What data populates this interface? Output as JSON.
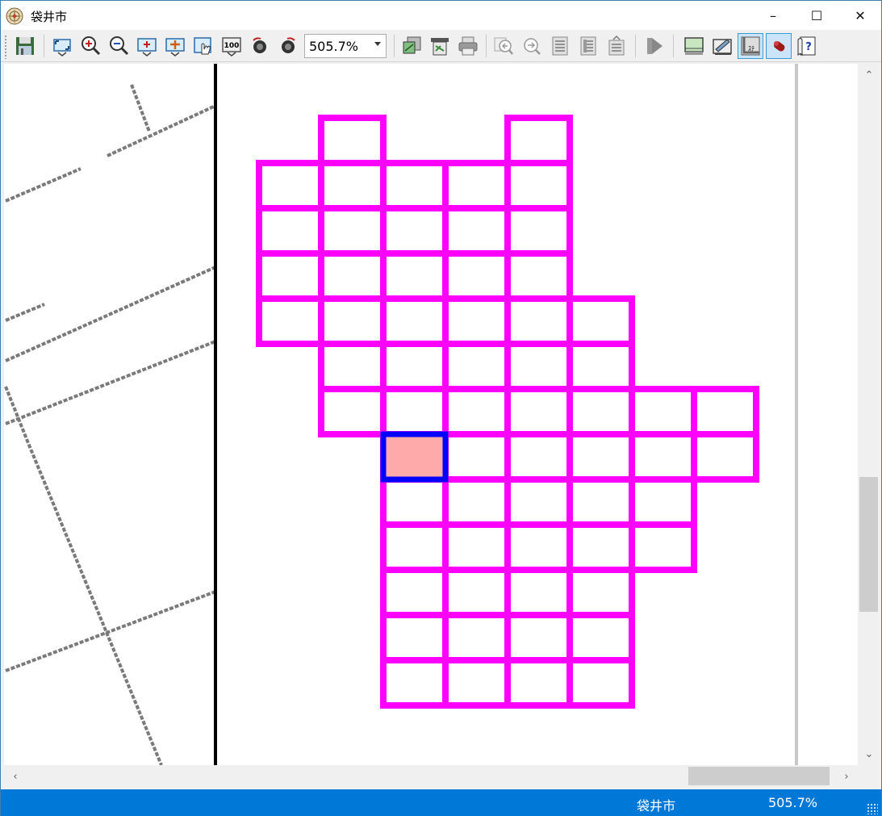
{
  "window": {
    "title": "袋井市",
    "minimize_glyph": "–",
    "maximize_glyph": "☐",
    "close_glyph": "✕"
  },
  "toolbar": {
    "zoom_value": "505.7%",
    "buttons": [
      "save-icon",
      "fit-all-icon",
      "zoom-in-icon",
      "zoom-out-icon",
      "zoom-center-icon",
      "pan-icon",
      "pan-hand-icon",
      "zoom-100-icon",
      "rotate-left-icon",
      "rotate-right-icon",
      "layer-icon",
      "print-setup-icon",
      "print-icon",
      "search-prev-icon",
      "search-next-icon",
      "list-icon",
      "list-detail-icon",
      "list-export-icon",
      "play-icon",
      "map-view-icon",
      "map-edit-icon",
      "status-icon",
      "marker-icon",
      "help-icon"
    ]
  },
  "map": {
    "grid_color": "#ff00ff",
    "selected_border_color": "#0000ff",
    "selected_fill_color": "#ffaaaa",
    "road_color": "#7a7a7a",
    "divider_color": "#000000"
  },
  "scrollbars": {
    "up_glyph": "⌃",
    "down_glyph": "⌄",
    "left_glyph": "‹",
    "right_glyph": "›"
  },
  "statusbar": {
    "area_name": "袋井市",
    "zoom": "505.7%",
    "accent": "#0078d7"
  }
}
